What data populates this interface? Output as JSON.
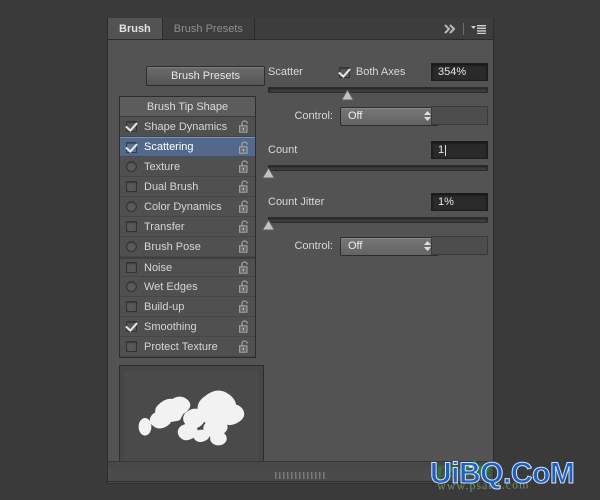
{
  "window": {
    "background_color": "#3a3a3a",
    "panel_background": "#535353"
  },
  "tabs": [
    {
      "label": "Brush",
      "active": true
    },
    {
      "label": "Brush Presets",
      "active": false
    }
  ],
  "tab_tools": {
    "collapse_label": "»",
    "menu_label": "menu"
  },
  "presets_button": {
    "label": "Brush Presets"
  },
  "options_list": {
    "header": "Brush Tip Shape",
    "items": [
      {
        "label": "Shape Dynamics",
        "checked": true,
        "round": false,
        "separator_above": false,
        "selected": false
      },
      {
        "label": "Scattering",
        "checked": true,
        "round": false,
        "separator_above": false,
        "selected": true
      },
      {
        "label": "Texture",
        "checked": false,
        "round": true,
        "separator_above": false,
        "selected": false
      },
      {
        "label": "Dual Brush",
        "checked": false,
        "round": false,
        "separator_above": false,
        "selected": false
      },
      {
        "label": "Color Dynamics",
        "checked": false,
        "round": true,
        "separator_above": false,
        "selected": false
      },
      {
        "label": "Transfer",
        "checked": false,
        "round": false,
        "separator_above": false,
        "selected": false
      },
      {
        "label": "Brush Pose",
        "checked": false,
        "round": true,
        "separator_above": false,
        "selected": false
      },
      {
        "label": "Noise",
        "checked": false,
        "round": false,
        "separator_above": true,
        "selected": false
      },
      {
        "label": "Wet Edges",
        "checked": false,
        "round": true,
        "separator_above": false,
        "selected": false
      },
      {
        "label": "Build-up",
        "checked": false,
        "round": false,
        "separator_above": false,
        "selected": false
      },
      {
        "label": "Smoothing",
        "checked": true,
        "round": false,
        "separator_above": false,
        "selected": false
      },
      {
        "label": "Protect Texture",
        "checked": false,
        "round": false,
        "separator_above": false,
        "selected": false
      }
    ],
    "lock_icon": "unlocked-padlock"
  },
  "scatter": {
    "title": "Scatter",
    "both_axes_label": "Both Axes",
    "both_axes_checked": true,
    "value": "354%",
    "slider_percent": 36,
    "control_label": "Control:",
    "control_value": "Off"
  },
  "count": {
    "title": "Count",
    "value": "1",
    "slider_percent": 0
  },
  "count_jitter": {
    "title": "Count Jitter",
    "value": "1%",
    "slider_percent": 0,
    "control_label": "Control:",
    "control_value": "Off"
  },
  "preview": {
    "name": "brush-stroke-preview"
  },
  "footer": {
    "toggle_icon": "brush-toggle-icon",
    "new_brush_icon": "new-brush-icon"
  },
  "grip": {
    "name": "resize-grip"
  },
  "watermarks": {
    "blue": "UiBQ.CoM",
    "green_main": "psahz",
    "green_sub": "www.psahz.com"
  }
}
